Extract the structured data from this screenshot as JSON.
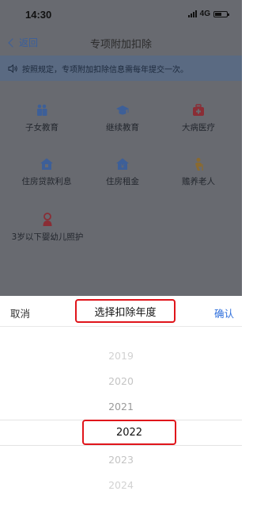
{
  "status_bar": {
    "time": "14:30",
    "network": "4G",
    "battery_level": 0.55
  },
  "nav": {
    "back_label": "返回",
    "title": "专项附加扣除"
  },
  "notice": {
    "text": "按照规定，专项附加扣除信息需每年提交一次。"
  },
  "categories": [
    {
      "label": "子女教育",
      "icon": "children-education-icon",
      "color": "#3d5f98"
    },
    {
      "label": "继续教育",
      "icon": "graduation-cap-icon",
      "color": "#3d5f98"
    },
    {
      "label": "大病医疗",
      "icon": "medical-kit-icon",
      "color": "#8a2d35"
    },
    {
      "label": "住房贷款利息",
      "icon": "house-loan-icon",
      "color": "#3d5f98"
    },
    {
      "label": "住房租金",
      "icon": "house-rent-icon",
      "color": "#3d5f98"
    },
    {
      "label": "赡养老人",
      "icon": "elderly-icon",
      "color": "#8a6a30"
    },
    {
      "label": "3岁以下婴幼儿照护",
      "icon": "infant-care-icon",
      "color": "#8a2d35"
    }
  ],
  "picker": {
    "cancel_label": "取消",
    "title": "选择扣除年度",
    "confirm_label": "确认",
    "years": [
      "2019",
      "2020",
      "2021",
      "2022",
      "2023",
      "2024"
    ],
    "selected": "2022"
  },
  "colors": {
    "highlight": "#e0151b",
    "accent": "#2f6fdc"
  }
}
